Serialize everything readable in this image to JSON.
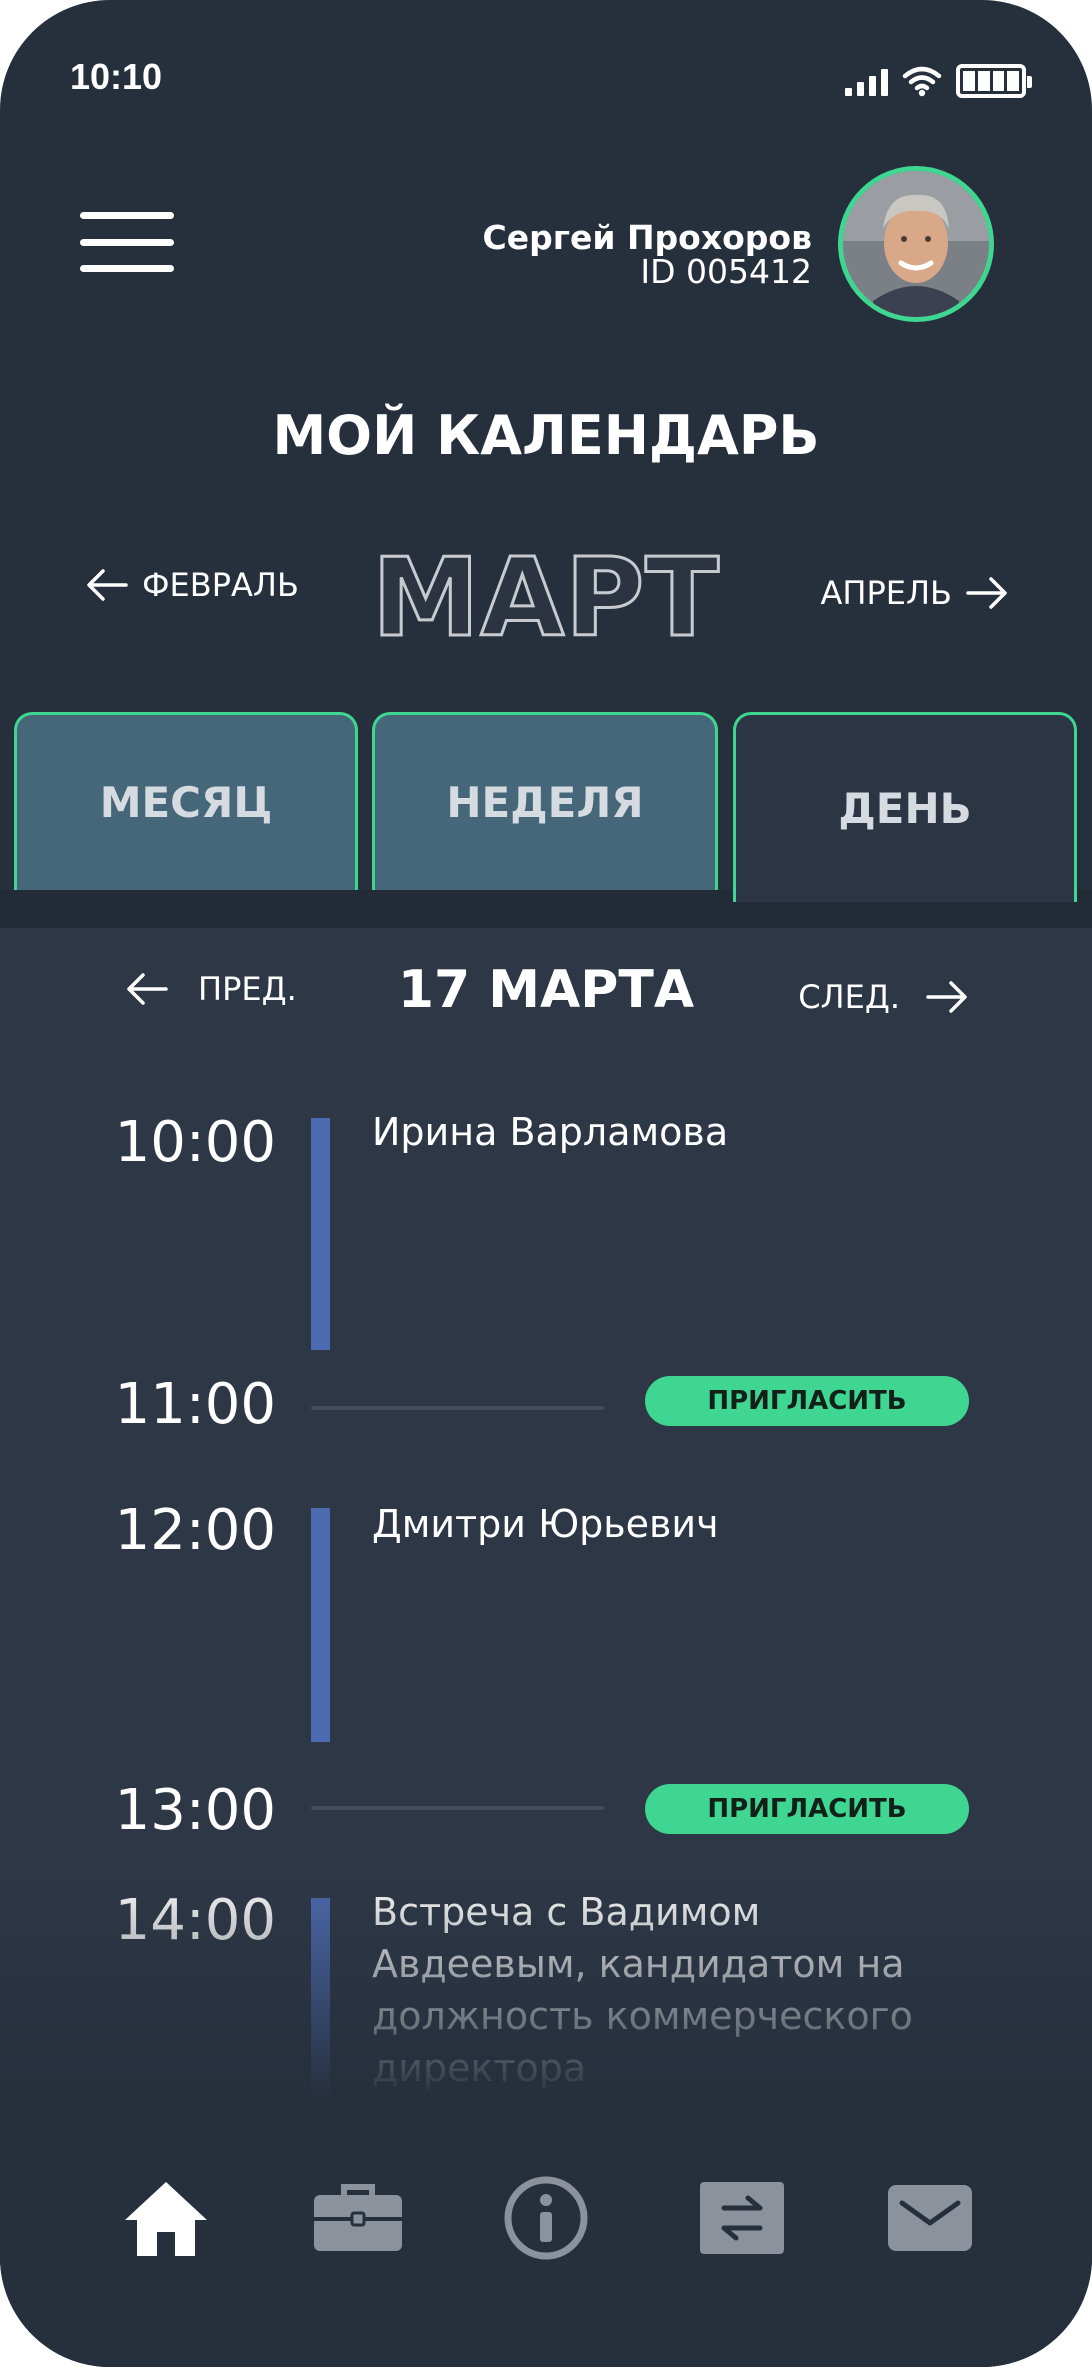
{
  "status": {
    "time": "10:10"
  },
  "user": {
    "name": "Сергей Прохоров",
    "id": "ID 005412"
  },
  "page": {
    "title": "МОЙ КАЛЕНДАРЬ"
  },
  "month_nav": {
    "prev": "ФЕВРАЛЬ",
    "current": "МАРТ",
    "next": "АПРЕЛЬ"
  },
  "view_tabs": [
    {
      "label": "МЕСЯЦ",
      "active": false
    },
    {
      "label": "НЕДЕЛЯ",
      "active": false
    },
    {
      "label": "ДЕНЬ",
      "active": true
    }
  ],
  "day_nav": {
    "prev": "ПРЕД.",
    "current": "17 МАРТА",
    "next": "СЛЕД."
  },
  "schedule": [
    {
      "time": "10:00",
      "event": "Ирина Варламова"
    },
    {
      "time": "11:00",
      "action": "ПРИГЛАСИТЬ"
    },
    {
      "time": "12:00",
      "event": "Дмитри Юрьевич"
    },
    {
      "time": "13:00",
      "action": "ПРИГЛАСИТЬ"
    },
    {
      "time": "14:00",
      "event": "Встреча с Вадимом Авдеевым, кандидатом на должность коммерческого директора"
    }
  ],
  "colors": {
    "accent": "#3fd691",
    "event_bar": "#4c6bb1",
    "background": "#262f3c",
    "tab": "#456779"
  },
  "bottom_nav": [
    {
      "icon": "home-icon",
      "active": true
    },
    {
      "icon": "briefcase-icon",
      "active": false
    },
    {
      "icon": "info-icon",
      "active": false
    },
    {
      "icon": "transfer-icon",
      "active": false
    },
    {
      "icon": "mail-icon",
      "active": false
    }
  ]
}
